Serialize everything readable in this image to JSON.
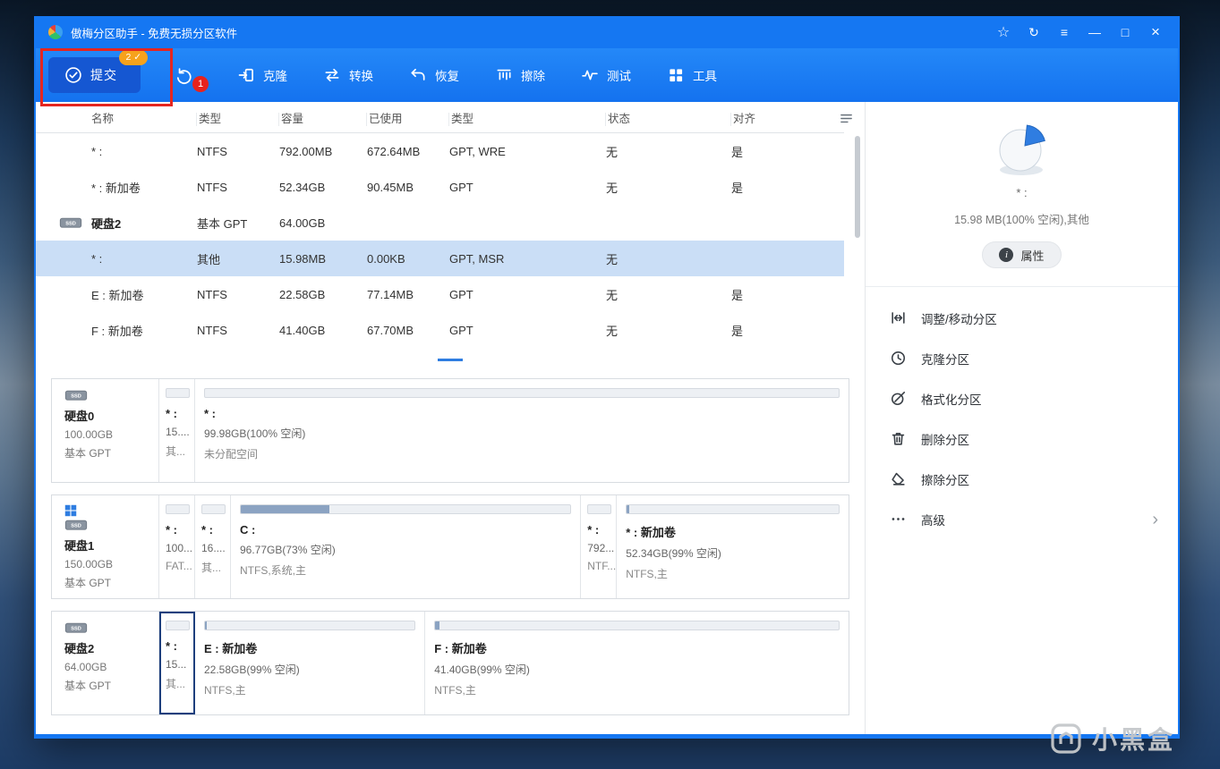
{
  "colors": {
    "accent_blue": "#1577f2",
    "submit_button_bg": "#1557d2",
    "selected_row_bg": "#cadef6",
    "badge_orange": "#f6a21c",
    "badge_red": "#e8231d",
    "capacity_bar_fill": "#8ba3c2",
    "pie_slice_blue": "#2f7de1",
    "selected_partition_border": "#1e3f7d"
  },
  "titlebar": {
    "title": "傲梅分区助手 - 免费无损分区软件",
    "controls": [
      {
        "name": "favorite",
        "glyph": "☆"
      },
      {
        "name": "refresh",
        "glyph": "↻"
      },
      {
        "name": "menu",
        "glyph": "≡"
      },
      {
        "name": "minimize",
        "glyph": "—"
      },
      {
        "name": "maximize",
        "glyph": "□"
      },
      {
        "name": "close",
        "glyph": "×"
      }
    ]
  },
  "toolbar": {
    "submit_label": "提交",
    "submit_badge": "2 ✓",
    "undo_badge": "1",
    "buttons": [
      {
        "icon": "clone",
        "label": "克隆"
      },
      {
        "icon": "convert",
        "label": "转换"
      },
      {
        "icon": "recover",
        "label": "恢复"
      },
      {
        "icon": "erase",
        "label": "擦除"
      },
      {
        "icon": "test",
        "label": "测试"
      },
      {
        "icon": "tools",
        "label": "工具"
      }
    ]
  },
  "table": {
    "headers": [
      "名称",
      "类型",
      "容量",
      "已使用",
      "类型",
      "状态",
      "对齐"
    ],
    "rows": [
      {
        "kind": "partition",
        "name": "* :",
        "type": "NTFS",
        "capacity": "792.00MB",
        "used": "672.64MB",
        "fs": "GPT, WRE",
        "status": "无",
        "aligned": "是"
      },
      {
        "kind": "partition",
        "name": "* : 新加卷",
        "type": "NTFS",
        "capacity": "52.34GB",
        "used": "90.45MB",
        "fs": "GPT",
        "status": "无",
        "aligned": "是"
      },
      {
        "kind": "disk",
        "name": "硬盘2",
        "type": "基本 GPT",
        "capacity": "64.00GB",
        "used": "",
        "fs": "",
        "status": "",
        "aligned": ""
      },
      {
        "kind": "partition",
        "selected": true,
        "name": "* :",
        "type": "其他",
        "capacity": "15.98MB",
        "used": "0.00KB",
        "fs": "GPT, MSR",
        "status": "无",
        "aligned": ""
      },
      {
        "kind": "partition",
        "name": "E : 新加卷",
        "type": "NTFS",
        "capacity": "22.58GB",
        "used": "77.14MB",
        "fs": "GPT",
        "status": "无",
        "aligned": "是"
      },
      {
        "kind": "partition",
        "name": "F : 新加卷",
        "type": "NTFS",
        "capacity": "41.40GB",
        "used": "67.70MB",
        "fs": "GPT",
        "status": "无",
        "aligned": "是"
      }
    ]
  },
  "disks": [
    {
      "name": "硬盘0",
      "size": "100.00GB",
      "type": "基本 GPT",
      "icon": "ssd",
      "partitions": [
        {
          "label": "* :",
          "size": "15....",
          "fs": "其...",
          "narrow": true,
          "fill": 0
        },
        {
          "label": "* :",
          "size": "99.98GB(100% 空闲)",
          "fs": "未分配空间",
          "flex": 730,
          "fill": 0
        }
      ]
    },
    {
      "name": "硬盘1",
      "size": "150.00GB",
      "type": "基本 GPT",
      "icon": "windows-ssd",
      "partitions": [
        {
          "label": "* :",
          "size": "100...",
          "fs": "FAT...",
          "narrow": true,
          "fill": 0
        },
        {
          "label": "* :",
          "size": "16....",
          "fs": "其...",
          "narrow": true,
          "fill": 0
        },
        {
          "label": "C :",
          "size": "96.77GB(73% 空闲)",
          "fs": "NTFS,系统,主",
          "flex": 400,
          "fill": 27
        },
        {
          "label": "* :",
          "size": "792...",
          "fs": "NTF...",
          "narrow": true,
          "fill": 0
        },
        {
          "label": "* : 新加卷",
          "size": "52.34GB(99% 空闲)",
          "fs": "NTFS,主",
          "flex": 258,
          "fill": 1
        }
      ]
    },
    {
      "name": "硬盘2",
      "size": "64.00GB",
      "type": "基本 GPT",
      "icon": "ssd",
      "partitions": [
        {
          "label": "* :",
          "size": "15...",
          "fs": "其...",
          "narrow": true,
          "fill": 0,
          "selected": true
        },
        {
          "label": "E : 新加卷",
          "size": "22.58GB(99% 空闲)",
          "fs": "NTFS,主",
          "flex": 253,
          "fill": 1
        },
        {
          "label": "F : 新加卷",
          "size": "41.40GB(99% 空闲)",
          "fs": "NTFS,主",
          "flex": 485,
          "fill": 1
        }
      ]
    }
  ],
  "sidebar": {
    "partition_label": "* :",
    "partition_info": "15.98 MB(100% 空闲),其他",
    "properties_label": "属性",
    "actions": [
      {
        "icon": "resize-move",
        "label": "调整/移动分区"
      },
      {
        "icon": "clone-partition",
        "label": "克隆分区"
      },
      {
        "icon": "format-partition",
        "label": "格式化分区"
      },
      {
        "icon": "delete-partition",
        "label": "删除分区"
      },
      {
        "icon": "erase-partition",
        "label": "擦除分区"
      },
      {
        "icon": "advanced",
        "label": "高级",
        "chevron": true
      }
    ]
  },
  "watermark": {
    "label": "小黑盒"
  }
}
